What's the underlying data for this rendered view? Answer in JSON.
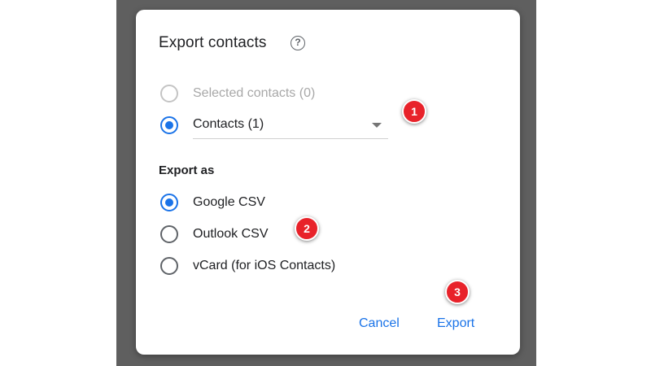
{
  "dialog": {
    "title": "Export contacts",
    "help_icon": "?",
    "source_options": [
      {
        "label": "Selected contacts (0)",
        "state": "disabled"
      },
      {
        "label": "Contacts (1)",
        "state": "selected"
      }
    ],
    "export_section_label": "Export as",
    "format_options": [
      {
        "label": "Google CSV",
        "state": "selected"
      },
      {
        "label": "Outlook CSV",
        "state": "unselected"
      },
      {
        "label": "vCard (for iOS Contacts)",
        "state": "unselected"
      }
    ],
    "cancel_label": "Cancel",
    "export_label": "Export"
  },
  "annotations": {
    "badge_1": "1",
    "badge_2": "2",
    "badge_3": "3"
  },
  "colors": {
    "accent": "#1a73e8",
    "badge": "#e8222a",
    "backdrop": "#5f5f5f"
  }
}
